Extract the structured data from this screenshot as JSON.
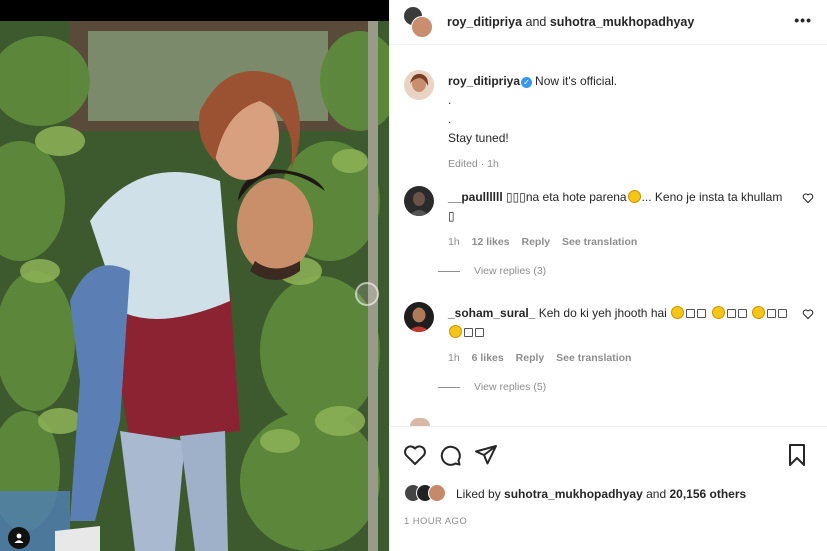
{
  "header": {
    "user1": "roy_ditipriya",
    "conjunction": "and",
    "user2": "suhotra_mukhopadhyay",
    "more_label": "•••"
  },
  "caption": {
    "username": "roy_ditipriya",
    "verified_icon": "verified-check",
    "line1": "Now it's official.",
    "line2": ".",
    "line3": ".",
    "line4": "Stay tuned!",
    "meta": "Edited · 1h"
  },
  "comments": [
    {
      "username": "__paullllll",
      "text_a": "▯▯▯na eta hote parena",
      "text_b": "... Keno je insta ta khullam",
      "text_c": "▯",
      "time": "1h",
      "likes": "12 likes",
      "reply": "Reply",
      "translate": "See translation",
      "view_replies": "View replies (3)"
    },
    {
      "username": "_soham_sural_",
      "text_a": "Keh do ki yeh jhooth hai",
      "time": "1h",
      "likes": "6 likes",
      "reply": "Reply",
      "translate": "See translation",
      "view_replies": "View replies (5)"
    }
  ],
  "likes": {
    "prefix": "Liked by",
    "user": "suhotra_mukhopadhyay",
    "and": "and",
    "count": "20,156 others"
  },
  "timestamp": "1 HOUR AGO",
  "colors": {
    "accent": "#3897f0",
    "muted": "#8e8e8e",
    "text": "#262626",
    "border": "#efefef"
  },
  "icons": [
    "heart-icon",
    "comment-icon",
    "share-icon",
    "bookmark-icon",
    "more-icon",
    "verified-icon"
  ]
}
